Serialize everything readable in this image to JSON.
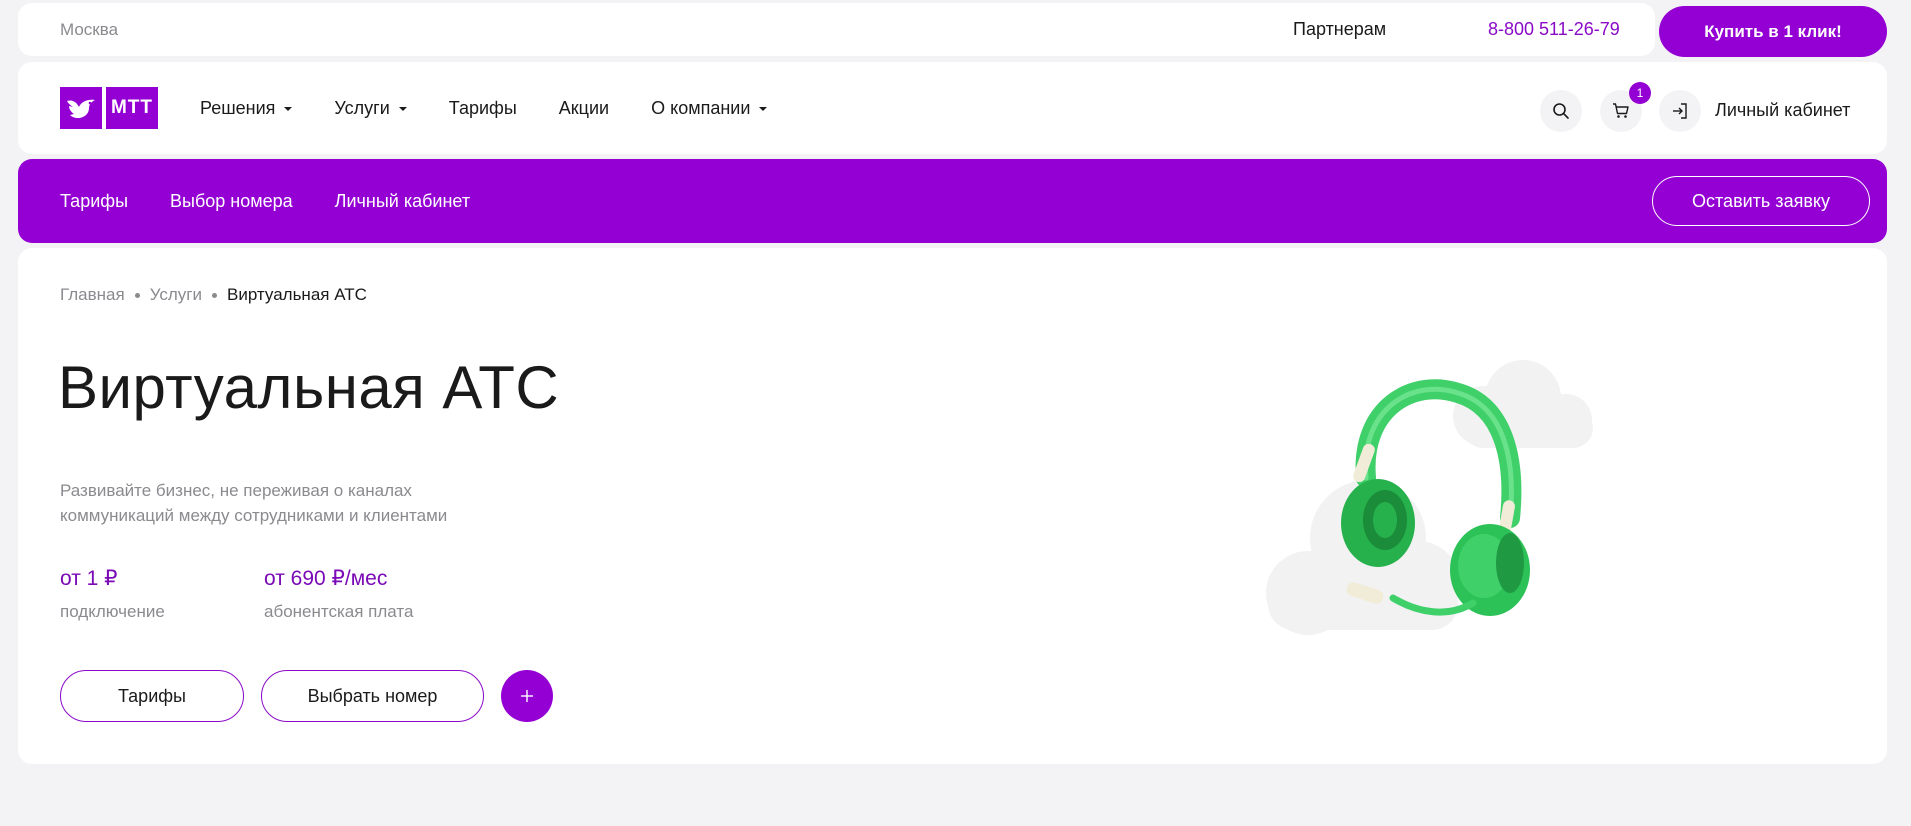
{
  "topbar": {
    "city": "Москва",
    "partners": "Партнерам",
    "phone": "8-800 511-26-79",
    "buy_button": "Купить в 1 клик!"
  },
  "header": {
    "logo_text": "МТТ",
    "nav": [
      {
        "label": "Решения",
        "has_dropdown": true
      },
      {
        "label": "Услуги",
        "has_dropdown": true
      },
      {
        "label": "Тарифы",
        "has_dropdown": false
      },
      {
        "label": "Акции",
        "has_dropdown": false
      },
      {
        "label": "О компании",
        "has_dropdown": true
      }
    ],
    "icons": [
      "search-icon",
      "cart-icon",
      "login-icon"
    ],
    "cart_count": "1",
    "cabinet_label": "Личный кабинет"
  },
  "band": {
    "links": [
      "Тарифы",
      "Выбор номера",
      "Личный кабинет"
    ],
    "request_button": "Оставить заявку"
  },
  "main": {
    "breadcrumb": [
      "Главная",
      "Услуги",
      "Виртуальная АТС"
    ],
    "title": "Виртуальная АТС",
    "description": "Развивайте бизнес, не переживая о каналах коммуникаций между сотрудниками и клиентами",
    "prices": [
      {
        "value": "от 1 ₽",
        "label": "подключение"
      },
      {
        "value": "от 690 ₽/мес",
        "label": "абонентская плата"
      }
    ],
    "buttons": {
      "tariffs": "Тарифы",
      "choose_number": "Выбрать номер"
    }
  },
  "colors": {
    "brand": "#9400d3",
    "accent_text": "#7a0ab5",
    "muted_text": "#8a8a8f",
    "background": "#f3f3f5"
  }
}
